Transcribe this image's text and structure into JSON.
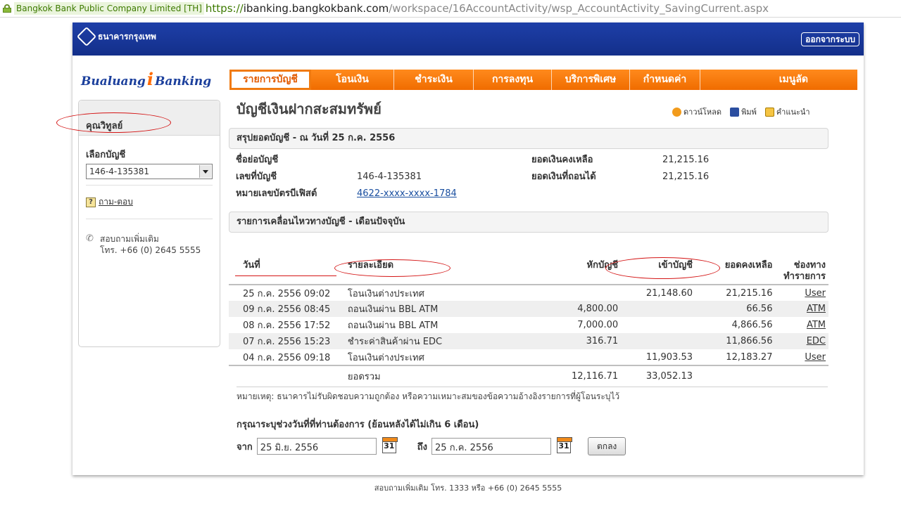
{
  "browser": {
    "site_identity": "Bangkok Bank Public Company Limited [TH]",
    "url_scheme": "https://",
    "url_host": "ibanking.bangkokbank.com",
    "url_path": "/workspace/16AccountActivity/wsp_AccountActivity_SavingCurrent.aspx"
  },
  "header": {
    "bank_name": "ธนาคารกรุงเทพ",
    "logout_label": "ออกจากระบบ",
    "brand_left": "Bualuang",
    "brand_mark": "i",
    "brand_right": "Banking"
  },
  "menu": {
    "items": [
      {
        "label": "รายการบัญชี"
      },
      {
        "label": "โอนเงิน"
      },
      {
        "label": "ชำระเงิน"
      },
      {
        "label": "การลงทุน"
      },
      {
        "label": "บริการพิเศษ"
      },
      {
        "label": "กำหนดค่า"
      },
      {
        "label": "เมนูลัด"
      }
    ]
  },
  "sidebar": {
    "customer_name": "คุณวิทูลย์",
    "select_label": "เลือกบัญชี",
    "selected_account": "146-4-135381",
    "faq_link": "ถาม-ตอบ",
    "contact_line1": "สอบถามเพิ่มเติม",
    "contact_line2": "โทร. +66 (0) 2645 5555"
  },
  "page": {
    "title": "บัญชีเงินฝากสะสมทรัพย์",
    "tools": [
      {
        "label": "ดาวน์โหลด",
        "icon": "download-icon"
      },
      {
        "label": "พิมพ์",
        "icon": "print-icon"
      },
      {
        "label": "คำแนะนำ",
        "icon": "help-icon"
      }
    ]
  },
  "summary": {
    "heading": "สรุปยอดบัญชี - ณ วันที่ 25 ก.ค. 2556",
    "nickname_label": "ชื่อย่อบัญชี",
    "nickname_value": "",
    "account_no_label": "เลขที่บัญชี",
    "account_no_value": "146-4-135381",
    "card_label": "หมายเลขบัตรบีเฟิสต์",
    "card_value": "4622-xxxx-xxxx-1784",
    "balance_label": "ยอดเงินคงเหลือ",
    "balance_value": "21,215.16",
    "available_label": "ยอดเงินที่ถอนได้",
    "available_value": "21,215.16"
  },
  "activity": {
    "heading": "รายการเคลื่อนไหวทางบัญชี - เดือนปัจจุบัน",
    "columns": {
      "date": "วันที่",
      "description": "รายละเอียด",
      "withdrawal": "หักบัญชี",
      "deposit": "เข้าบัญชี",
      "balance": "ยอดคงเหลือ",
      "channel_line1": "ช่องทาง",
      "channel_line2": "ทำรายการ"
    },
    "rows": [
      {
        "date": "25 ก.ค. 2556 09:02",
        "description": "โอนเงินต่างประเทศ",
        "withdrawal": "",
        "deposit": "21,148.60",
        "balance": "21,215.16",
        "channel": "User"
      },
      {
        "date": "09 ก.ค. 2556 08:45",
        "description": "ถอนเงินผ่าน BBL ATM",
        "withdrawal": "4,800.00",
        "deposit": "",
        "balance": "66.56",
        "channel": "ATM"
      },
      {
        "date": "08 ก.ค. 2556 17:52",
        "description": "ถอนเงินผ่าน BBL ATM",
        "withdrawal": "7,000.00",
        "deposit": "",
        "balance": "4,866.56",
        "channel": "ATM"
      },
      {
        "date": "07 ก.ค. 2556 15:23",
        "description": "ชำระค่าสินค้าผ่าน EDC",
        "withdrawal": "316.71",
        "deposit": "",
        "balance": "11,866.56",
        "channel": "EDC"
      },
      {
        "date": "04 ก.ค. 2556 09:18",
        "description": "โอนเงินต่างประเทศ",
        "withdrawal": "",
        "deposit": "11,903.53",
        "balance": "12,183.27",
        "channel": "User"
      }
    ],
    "total_label": "ยอดรวม",
    "total_withdrawal": "12,116.71",
    "total_deposit": "33,052.13"
  },
  "note": "หมายเหตุ: ธนาคารไม่รับผิดชอบความถูกต้อง หรือความเหมาะสมของข้อความอ้างอิงรายการที่ผู้โอนระบุไว้",
  "range": {
    "prompt": "กรุณาระบุช่วงวันที่ที่ท่านต้องการ  (ย้อนหลังได้ไม่เกิน 6 เดือน)",
    "from_label": "จาก",
    "from_value": "25 มิ.ย. 2556",
    "to_label": "ถึง",
    "to_value": "25 ก.ค. 2556",
    "calendar_text": "31",
    "submit_label": "ตกลง"
  },
  "footer": "สอบถามเพิ่มเติม โทร. 1333 หรือ +66 (0) 2645 5555",
  "colors": {
    "header_blue": "#1e3fa8",
    "menu_orange": "#f27a10",
    "annotation_red": "#d41414"
  }
}
